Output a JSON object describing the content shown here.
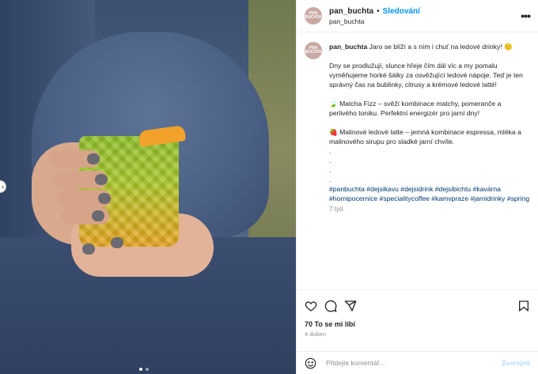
{
  "header": {
    "username": "pan_buchta",
    "separator": "•",
    "follow_label": "Sledování",
    "subline": "pan_buchta",
    "avatar_text": "PAN BUCHTA",
    "more_label": "•••"
  },
  "caption": {
    "username": "pan_buchta",
    "intro": "Jaro se blíží a s ním i chuť na ledové drinky! 🙂",
    "para1": "Dny se prodlužují, slunce hřeje čím dál víc a my pomalu vyměňujeme horké šálky za osvěžující ledové nápoje. Teď je ten správný čas na bublinky, citrusy a krémové ledové latté!",
    "para2": "🍃 Matcha Fizz – svěží kombinace matchy, pomeranče a perlivého toniku. Perfektní energizér pro jarní dny!",
    "para3": "🍓 Malinové ledové latte – jemná kombinace espressa, mléka a malinového sirupu pro sladké jarní chvíle.",
    "dots": [
      ".",
      ".",
      ".",
      "."
    ],
    "hashtags_line1": "#panbuchta #dejsikavu #dejsidrink #dejsibichtu #kavárna",
    "hashtags_line2": "#hornipocernice #specialitycoffee #kamvpraze #jarnidrinky #spring",
    "time": "7 týd."
  },
  "actions": {
    "likes": "70 To se mi líbí",
    "date": "4 duben"
  },
  "comment": {
    "placeholder": "Přidejte komentář...",
    "publish_label": "Zveřejnit"
  },
  "carousel": {
    "next_label": "‹",
    "total": 2,
    "current": 1
  },
  "colors": {
    "accent": "#0095f6",
    "hashtag": "#00376b",
    "muted": "#8e8e8e",
    "publish_disabled": "#b3dbff"
  }
}
